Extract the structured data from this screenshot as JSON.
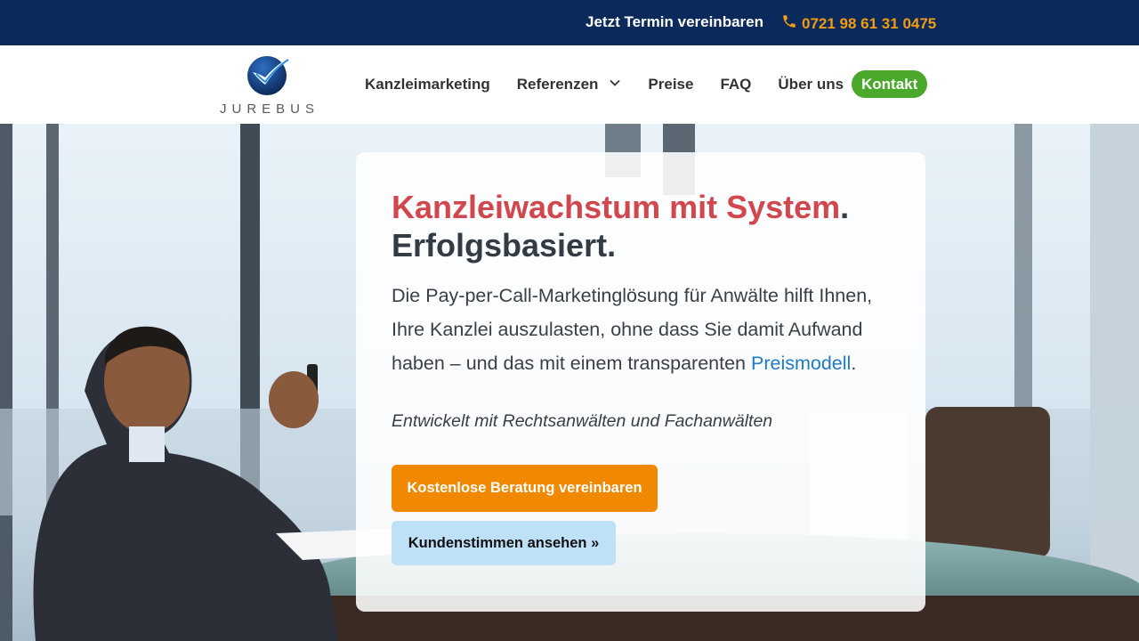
{
  "topbar": {
    "cta_label": "Jetzt Termin vereinbaren",
    "phone_label": "0721 98 61 31 0475",
    "phone_icon": "phone-icon",
    "background_color": "#0b2a5b",
    "phone_color": "#f39c12"
  },
  "header": {
    "logo_text": "JUREBUS",
    "logo_icon": "checkmark-globe-icon",
    "nav": [
      {
        "label": "Kanzleimarketing"
      },
      {
        "label": "Referenzen",
        "icon": "chevron-down-icon"
      },
      {
        "label": "Preise"
      },
      {
        "label": "FAQ"
      },
      {
        "label": "Über uns"
      }
    ],
    "contact_label": "Kontakt",
    "contact_color": "#4aa82a"
  },
  "hero": {
    "headline_accent": "Kanzleiwachstum mit System",
    "headline_dot": ".",
    "headline_rest": "Erfolgsbasiert.",
    "intro_text": "Die Pay-per-Call-Marketinglösung für Anwälte hilft Ihnen, Ihre Kanzlei auszulasten, ohne dass Sie damit Aufwand haben – und das mit einem transparenten ",
    "intro_link": "Preismodell",
    "intro_end": ".",
    "tagline": "Entwickelt mit Rechtsanwälten und Fachanwälten",
    "primary_button": "Kostenlose Beratung vereinbaren",
    "secondary_button": "Kundenstimmen ansehen »",
    "accent_color": "#d0474d",
    "primary_color": "#f08800",
    "secondary_color": "#bfe1f7",
    "link_color": "#1f7ac4"
  }
}
